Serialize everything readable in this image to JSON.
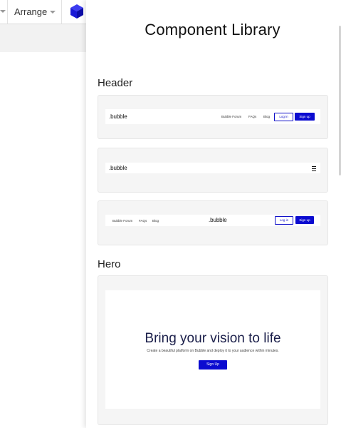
{
  "toolbar": {
    "arrange_label": "Arrange",
    "cube_icon": "cube-icon",
    "accent": "#1a1ad6"
  },
  "panel": {
    "title": "Component Library",
    "sections": {
      "header": {
        "label": "Header",
        "variant1": {
          "logo": ".bubble",
          "nav": [
            "Bubble Forum",
            "FAQs",
            "Blog"
          ],
          "login": "Log in",
          "signup": "Sign up"
        },
        "variant2": {
          "logo": ".bubble",
          "menu_icon": "hamburger-menu-icon"
        },
        "variant3": {
          "nav": [
            "Bubble Forum",
            "FAQs",
            "Blog"
          ],
          "logo": ".bubble",
          "login": "Log in",
          "signup": "Sign up"
        }
      },
      "hero": {
        "label": "Hero",
        "title": "Bring your vision to life",
        "subtitle": "Create a beautiful platform on Bubble and deploy it to your audience within minutes.",
        "button": "Sign Up"
      }
    }
  },
  "colors": {
    "brand_blue": "#0b0bd0",
    "hero_title": "#1b1f4a",
    "card_bg": "#f5f5f5"
  }
}
